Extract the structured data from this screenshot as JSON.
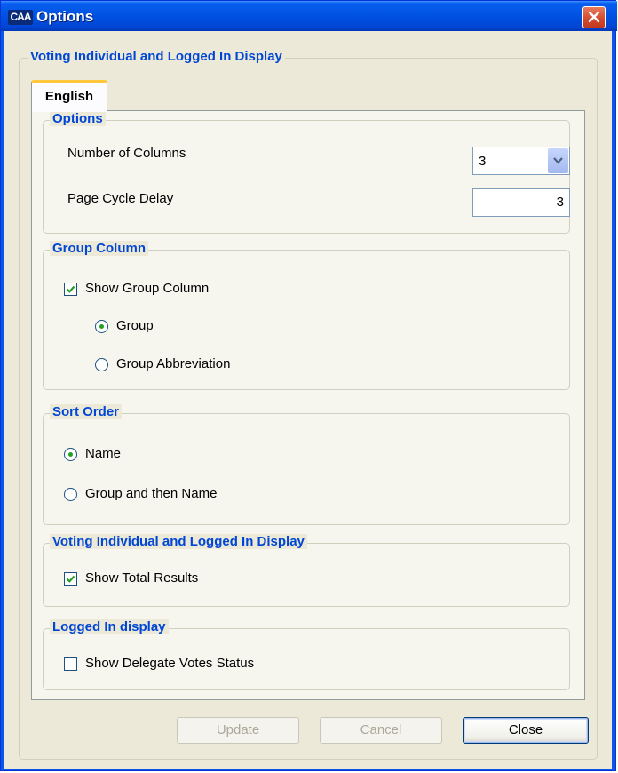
{
  "window": {
    "app_icon_text": "CAA",
    "title": "Options"
  },
  "outer_group": {
    "title": "Voting Individual and Logged In Display"
  },
  "tabs": [
    {
      "label": "English",
      "selected": true
    }
  ],
  "options": {
    "title": "Options",
    "columns_label": "Number of Columns",
    "columns_value": "3",
    "delay_label": "Page Cycle Delay",
    "delay_value": "3"
  },
  "group_column": {
    "title": "Group Column",
    "show_label": "Show Group Column",
    "show_checked": true,
    "group_label": "Group",
    "group_selected": true,
    "abbrev_label": "Group Abbreviation",
    "abbrev_selected": false
  },
  "sort_order": {
    "title": "Sort Order",
    "name_label": "Name",
    "name_selected": true,
    "group_name_label": "Group and then Name",
    "group_name_selected": false
  },
  "voting_display": {
    "title": "Voting Individual and Logged In Display",
    "show_total_label": "Show Total Results",
    "show_total_checked": true
  },
  "logged_in": {
    "title": "Logged In display",
    "delegate_label": "Show Delegate Votes Status",
    "delegate_checked": false
  },
  "buttons": {
    "update": "Update",
    "cancel": "Cancel",
    "close": "Close"
  },
  "colors": {
    "title_bar": "#0055e5",
    "group_title": "#0046d5",
    "tab_highlight": "#ffc83c",
    "check_mark": "#21a121"
  }
}
